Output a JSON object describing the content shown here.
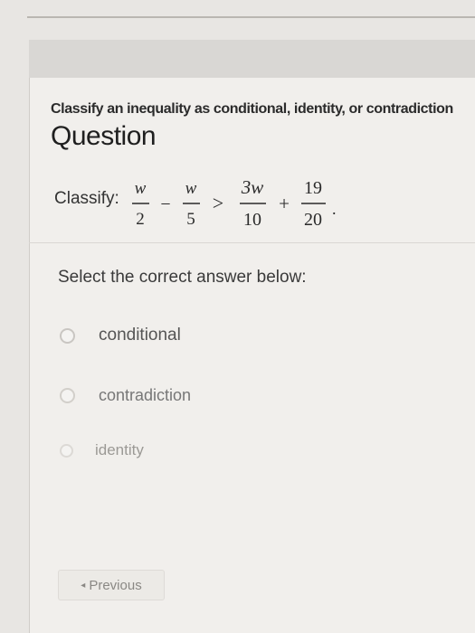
{
  "header": {
    "subtitle": "Classify an inequality as conditional, identity, or contradiction",
    "title": "Question"
  },
  "question": {
    "label": "Classify:",
    "expression": {
      "term1_num": "w",
      "term1_den": "2",
      "op1": "−",
      "term2_num": "w",
      "term2_den": "5",
      "relation": ">",
      "term3_num": "3w",
      "term3_den": "10",
      "op2": "+",
      "term4_num": "19",
      "term4_den": "20",
      "end": "."
    },
    "prompt": "Select the correct answer below:"
  },
  "options": [
    {
      "label": "conditional"
    },
    {
      "label": "contradiction"
    },
    {
      "label": "identity"
    }
  ],
  "nav": {
    "previous_label": "Previous"
  }
}
